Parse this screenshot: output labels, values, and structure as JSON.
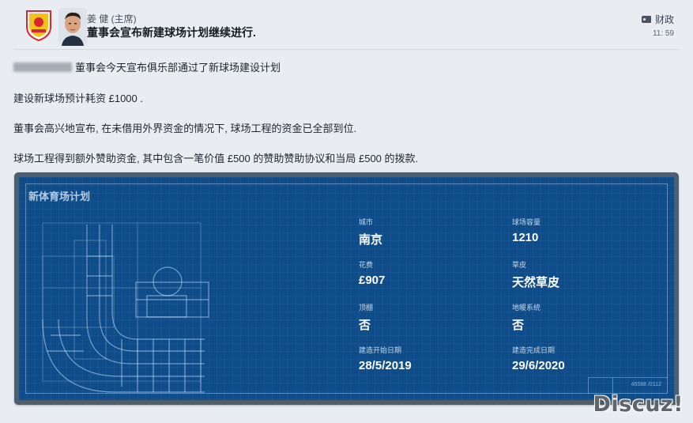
{
  "header": {
    "sender": "姜 健 (主席)",
    "subject": "董事会宣布新建球场计划继续进行.",
    "category": "财政",
    "time": "11: 59",
    "crest_icon": "club-crest-icon",
    "avatar_icon": "chairman-avatar"
  },
  "body": {
    "line1": "董事会今天宣布俱乐部通过了新球场建设计划",
    "line2": "建设新球场预计耗资 £1000 .",
    "line3": "董事会高兴地宣布, 在未借用外界资金的情况下, 球场工程的资金已全部到位.",
    "line4": "球场工程得到额外赞助资金, 其中包含一笔价值 £500 的赞助赞助协议和当局 £500 的拨款."
  },
  "plan": {
    "title": "新体育场计划",
    "city_label": "城市",
    "city_value": "南京",
    "capacity_label": "球场容量",
    "capacity_value": "1210",
    "cost_label": "花费",
    "cost_value": "£907",
    "pitch_label": "草皮",
    "pitch_value": "天然草皮",
    "roof_label": "顶棚",
    "roof_value": "否",
    "heating_label": "地暖系统",
    "heating_value": "否",
    "start_label": "建造开始日期",
    "start_value": "28/5/2019",
    "end_label": "建造完成日期",
    "end_value": "29/6/2020",
    "stamp": "45588 /0112"
  },
  "watermark": "Discuz!",
  "colors": {
    "background": "#e9edf1",
    "blueprint": "#0e4c8a",
    "panel_border": "#4d5f6d",
    "crest_red": "#d8262e"
  }
}
